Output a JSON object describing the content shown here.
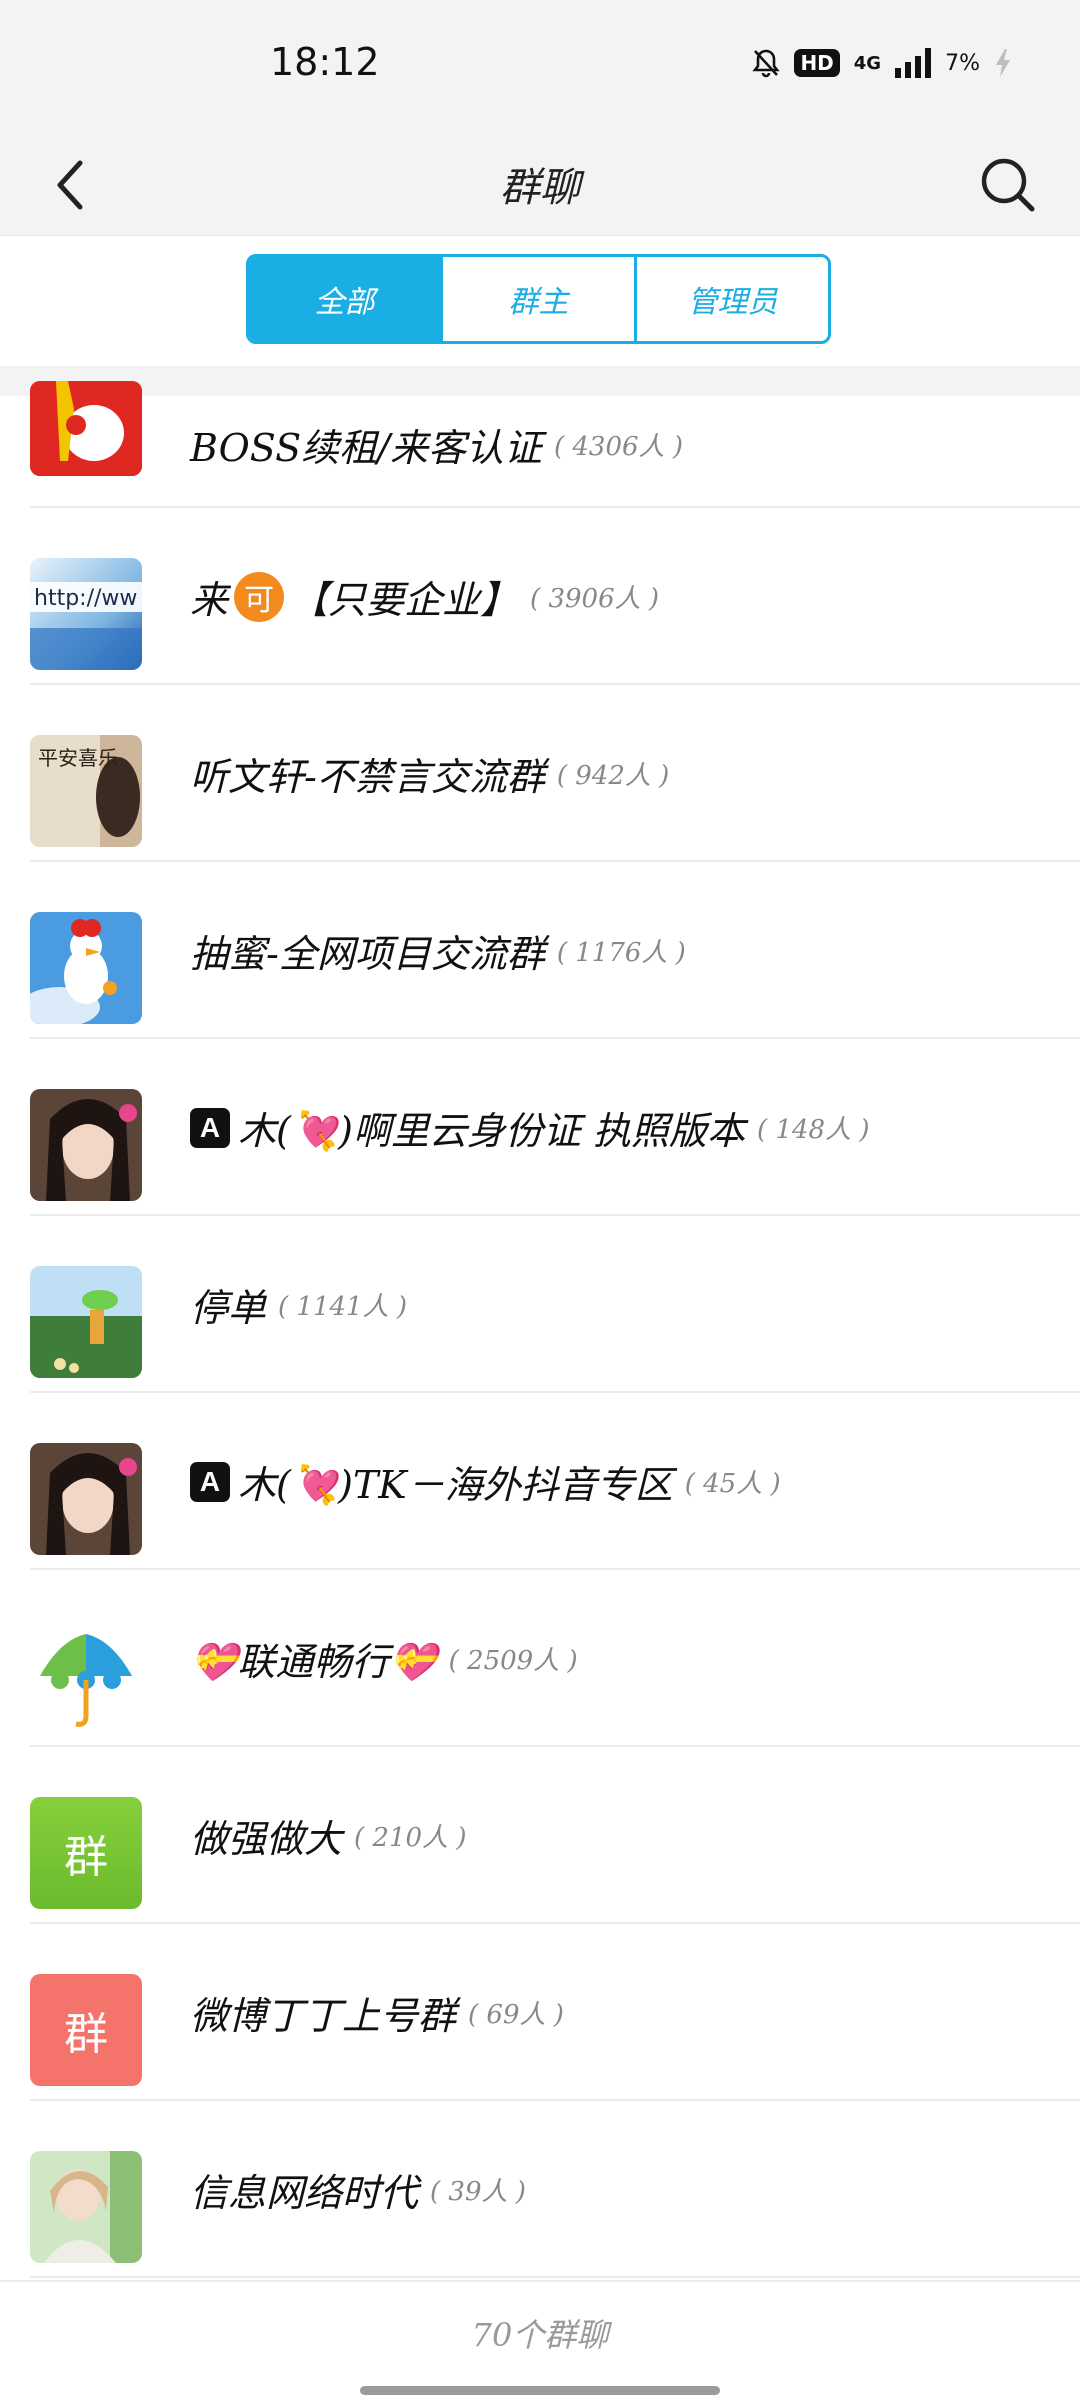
{
  "status": {
    "time": "18:12",
    "hd": "HD",
    "network": "4G",
    "battery": "7%"
  },
  "header": {
    "title": "群聊"
  },
  "tabs": [
    {
      "label": "全部",
      "active": true
    },
    {
      "label": "群主",
      "active": false
    },
    {
      "label": "管理员",
      "active": false
    }
  ],
  "groups": [
    {
      "name": "BOSS续租/来客认证",
      "count": "( 4306人 )",
      "avatar": "red-logo"
    },
    {
      "name_pre": "来",
      "badge": "可",
      "name_post": "【只要企业】",
      "count": "( 3906人 )",
      "avatar": "http-image"
    },
    {
      "name": "听文轩-不禁言交流群",
      "count": "( 942人 )",
      "avatar": "calligraphy-photo",
      "avatar_text": "平安喜乐"
    },
    {
      "name": "抽蜜-全网项目交流群",
      "count": "( 1176人 )",
      "avatar": "duck-photo"
    },
    {
      "badge": "A",
      "name": "木(💘)啊里云身份证 执照版本",
      "count": "( 148人 )",
      "avatar": "woman-photo"
    },
    {
      "name": "停单",
      "count": "( 1141人 )",
      "avatar": "cartoon-scene"
    },
    {
      "badge": "A",
      "name": "木(💘)TK－海外抖音专区",
      "count": "( 45人 )",
      "avatar": "woman-photo"
    },
    {
      "name": "💝联通畅行💝",
      "count": "( 2509人 )",
      "avatar": "umbrella-logo"
    },
    {
      "name": "做强做大",
      "count": "( 210人 )",
      "avatar": "text-avatar",
      "avatar_text": "群",
      "avatar_color": "#7fcb3a"
    },
    {
      "name": "微博丁丁上号群",
      "count": "( 69人 )",
      "avatar": "text-avatar",
      "avatar_text": "群",
      "avatar_color": "#f4736b"
    },
    {
      "name": "信息网络时代",
      "count": "( 39人 )",
      "avatar": "girl-photo"
    }
  ],
  "footer": {
    "summary": "70个群聊"
  }
}
